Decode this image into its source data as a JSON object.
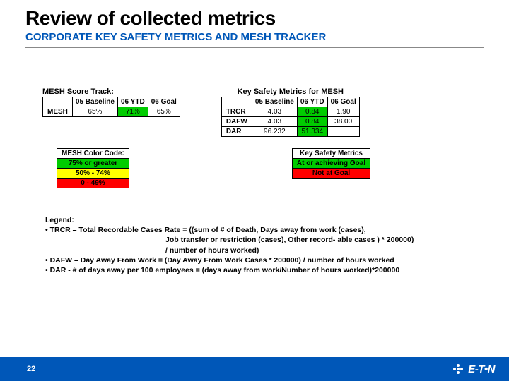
{
  "title": "Review of collected metrics",
  "subtitle": "CORPORATE KEY SAFETY METRICS AND MESH TRACKER",
  "meshTrack": {
    "title": "MESH Score Track:",
    "cols": [
      "05 Baseline",
      "06 YTD",
      "06 Goal"
    ],
    "rowLabel": "MESH",
    "cells": [
      {
        "v": "65%",
        "cls": ""
      },
      {
        "v": "71%",
        "cls": "green"
      },
      {
        "v": "65%",
        "cls": ""
      }
    ]
  },
  "ksm": {
    "title": "Key Safety Metrics for MESH",
    "cols": [
      "05 Baseline",
      "06 YTD",
      "06 Goal"
    ],
    "rows": [
      {
        "label": "TRCR",
        "cells": [
          {
            "v": "4.03",
            "cls": ""
          },
          {
            "v": "0.84",
            "cls": "green"
          },
          {
            "v": "1.90",
            "cls": ""
          }
        ]
      },
      {
        "label": "DAFW",
        "cells": [
          {
            "v": "4.03",
            "cls": ""
          },
          {
            "v": "0.84",
            "cls": "green"
          },
          {
            "v": "38.00",
            "cls": ""
          }
        ]
      },
      {
        "label": "DAR",
        "cells": [
          {
            "v": "96.232",
            "cls": ""
          },
          {
            "v": "51.334",
            "cls": "green"
          },
          {
            "v": "",
            "cls": ""
          }
        ]
      }
    ]
  },
  "colorCode": {
    "title": "MESH Color Code:",
    "rows": [
      {
        "v": "75% or greater",
        "cls": "green"
      },
      {
        "v": "50% - 74%",
        "cls": "yellow"
      },
      {
        "v": "0 - 49%",
        "cls": "red"
      }
    ]
  },
  "ksmLegend": {
    "title": "Key Safety Metrics",
    "rows": [
      {
        "v": "At or achieving Goal",
        "cls": "green"
      },
      {
        "v": "Not at Goal",
        "cls": "red"
      }
    ]
  },
  "legend": {
    "heading": "Legend:",
    "l1a": "• TRCR – Total Recordable Cases Rate = ((sum of  # of Death, Days away from work (cases),",
    "l1b": "Job transfer or restriction (cases), Other record- able cases ) * 200000)",
    "l1c": "/ number of hours worked)",
    "l2": "• DAFW – Day Away From Work = (Day Away From Work Cases * 200000)  / number of hours worked",
    "l3": "• DAR - # of days away per 100 employees = (days away from work/Number of hours worked)*200000"
  },
  "page": "22",
  "logo": "E-T•N"
}
